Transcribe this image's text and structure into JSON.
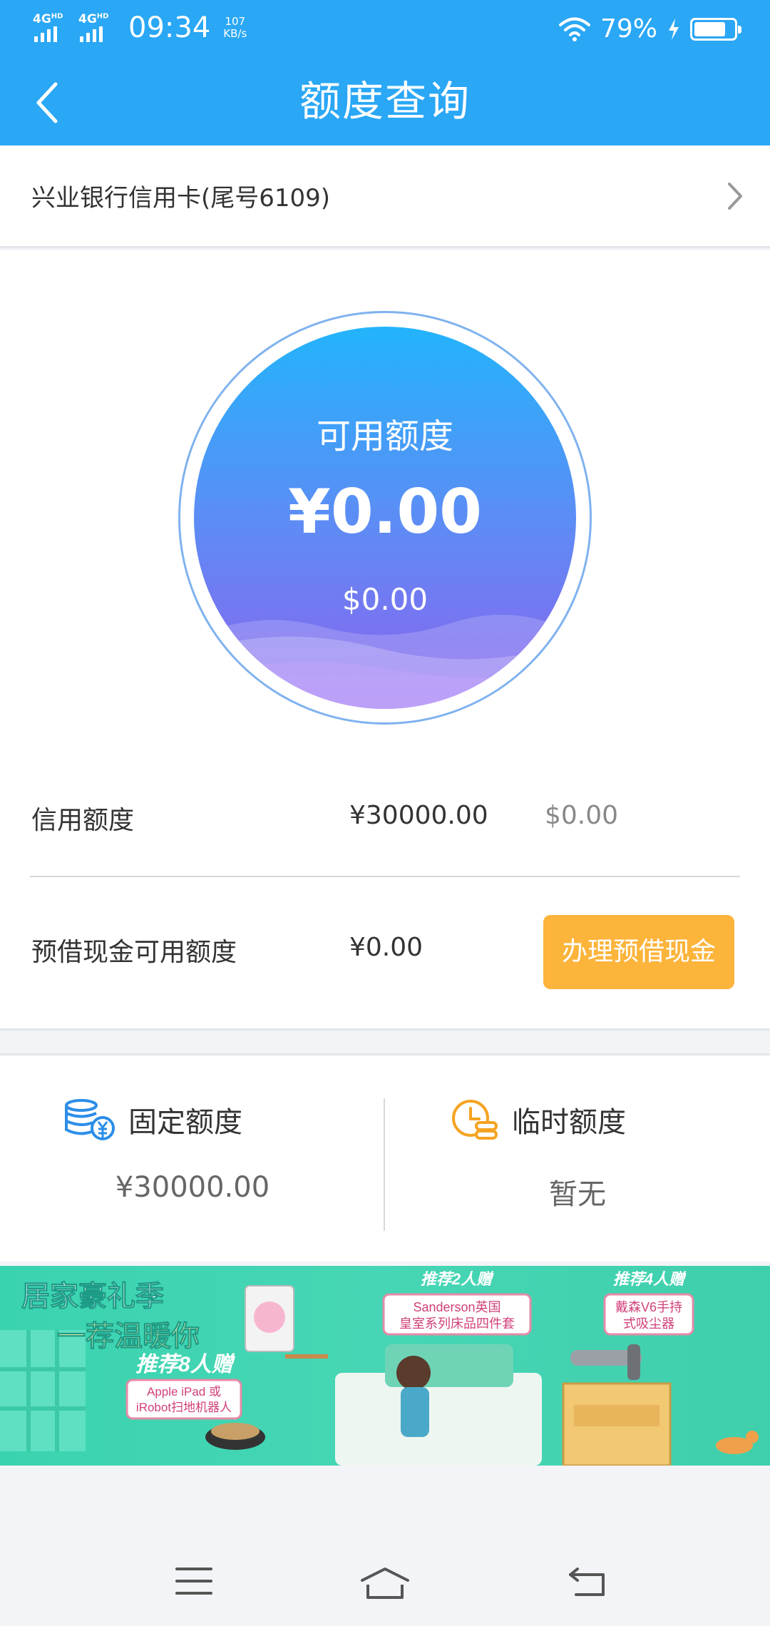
{
  "status_bar": {
    "network1": "4G",
    "network2": "4G",
    "network_sup": "HD",
    "time": "09:34",
    "speed_value": "107",
    "speed_unit": "KB/s",
    "battery": "79%",
    "battery_level": 0.79
  },
  "nav": {
    "title": "额度查询",
    "back_icon": "chevron-left-icon"
  },
  "card": {
    "label": "兴业银行信用卡(尾号6109)",
    "chevron_icon": "chevron-right-icon"
  },
  "gauge": {
    "title": "可用额度",
    "amount_cny": "¥0.00",
    "amount_usd": "$0.00"
  },
  "credit_limit": {
    "label": "信用额度",
    "cny": "¥30000.00",
    "usd": "$0.00"
  },
  "cash_advance": {
    "label": "预借现金可用额度",
    "cny": "¥0.00",
    "button": "办理预借现金"
  },
  "fixed_quota": {
    "label": "固定额度",
    "value": "¥30000.00",
    "icon": "coin-stack-icon"
  },
  "temp_quota": {
    "label": "临时额度",
    "value": "暂无",
    "icon": "clock-coins-icon"
  },
  "banner": {
    "headline1": "居家豪礼季",
    "headline2": "一荐温暖你",
    "offer_main": "推荐8人赠",
    "offer_main_prize1": "Apple iPad 或",
    "offer_main_prize2": "iRobot扫地机器人",
    "offer2_title": "推荐2人赠",
    "offer2_prize1": "Sanderson英国",
    "offer2_prize2": "皇室系列床品四件套",
    "offer4_title": "推荐4人赠",
    "offer4_prize1": "戴森V6手持",
    "offer4_prize2": "式吸尘器"
  },
  "colors": {
    "primary": "#2aa7f5",
    "button": "#fcb43b",
    "icon_blue": "#2c8ee8",
    "icon_orange": "#f5a322"
  }
}
